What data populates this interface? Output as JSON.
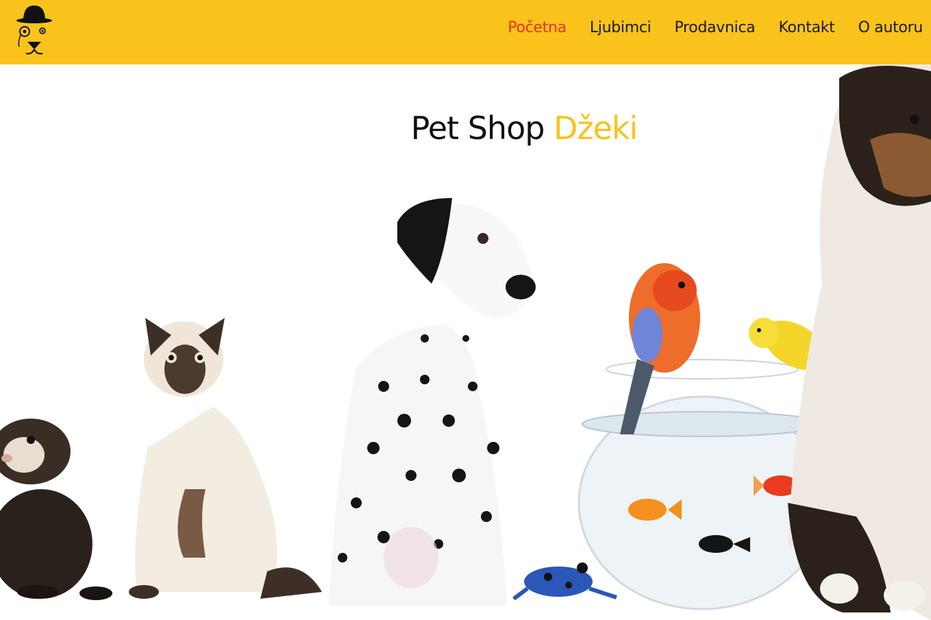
{
  "nav": {
    "items": [
      {
        "label": "Početna",
        "active": true
      },
      {
        "label": "Ljubimci",
        "active": false
      },
      {
        "label": "Prodavnica",
        "active": false
      },
      {
        "label": "Kontakt",
        "active": false
      },
      {
        "label": "O autoru",
        "active": false
      }
    ]
  },
  "hero": {
    "title_main": "Pet Shop",
    "title_accent": "Džeki"
  },
  "colors": {
    "header_bg": "#f9c31c",
    "active_nav": "#e8321c",
    "accent": "#f9c31c"
  },
  "icons": {
    "logo": "dog-with-bowler-hat-and-monocle-icon"
  }
}
